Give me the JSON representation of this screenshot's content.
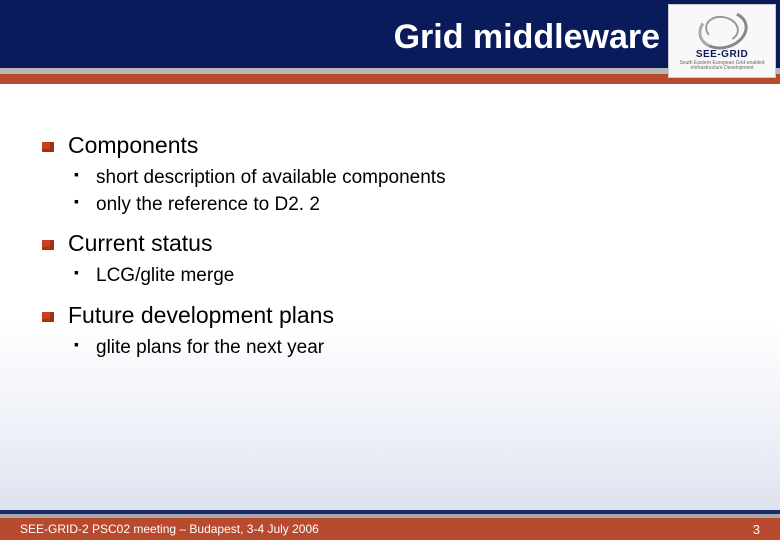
{
  "slide": {
    "title": "Grid middleware",
    "logo": {
      "name": "SEE-GRID",
      "subtitle": "South Eastern European Grid-enabled eInfrastructure Development"
    },
    "sections": [
      {
        "heading": "Components",
        "items": [
          "short description of available components",
          "only the reference to D2. 2"
        ]
      },
      {
        "heading": "Current status",
        "items": [
          "LCG/glite merge"
        ]
      },
      {
        "heading": "Future development plans",
        "items": [
          "glite plans for the next year"
        ]
      }
    ],
    "footer": {
      "text": "SEE-GRID-2 PSC02 meeting – Budapest, 3-4 July 2006",
      "page": "3"
    }
  }
}
